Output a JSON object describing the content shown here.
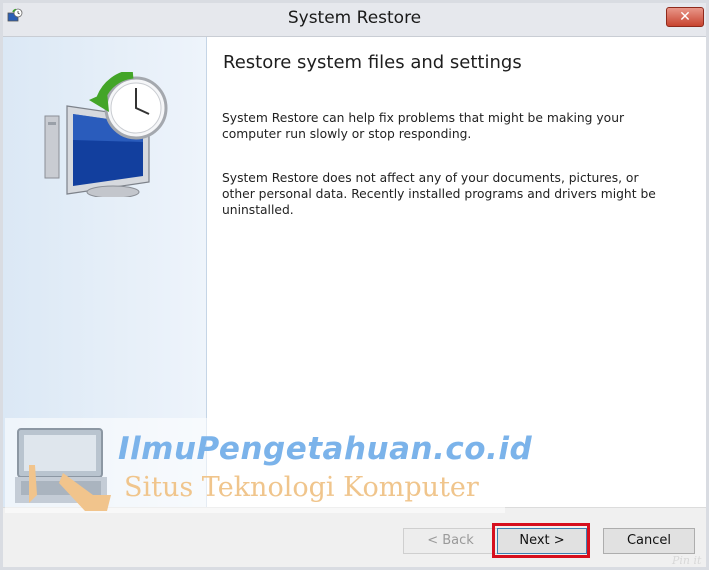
{
  "window": {
    "title": "System Restore",
    "close_label": "✕"
  },
  "main": {
    "heading": "Restore system files and settings",
    "paragraph1": "System Restore can help fix problems that might be making your computer run slowly or stop responding.",
    "paragraph2": "System Restore does not affect any of your documents, pictures, or other personal data. Recently installed programs and drivers might be uninstalled."
  },
  "footer": {
    "back_label": "< Back",
    "next_label": "Next >",
    "cancel_label": "Cancel"
  },
  "watermark": {
    "title": "IlmuPengetahuan.co.id",
    "subtitle": "Situs Teknologi Komputer",
    "pin_label": "Pin it"
  },
  "icons": {
    "app": "system-restore-icon",
    "illustration": "computer-clock-restore-icon",
    "watermark": "laptop-hand-icon"
  },
  "colors": {
    "highlight": "#d60f1e",
    "close": "#c7442f"
  }
}
